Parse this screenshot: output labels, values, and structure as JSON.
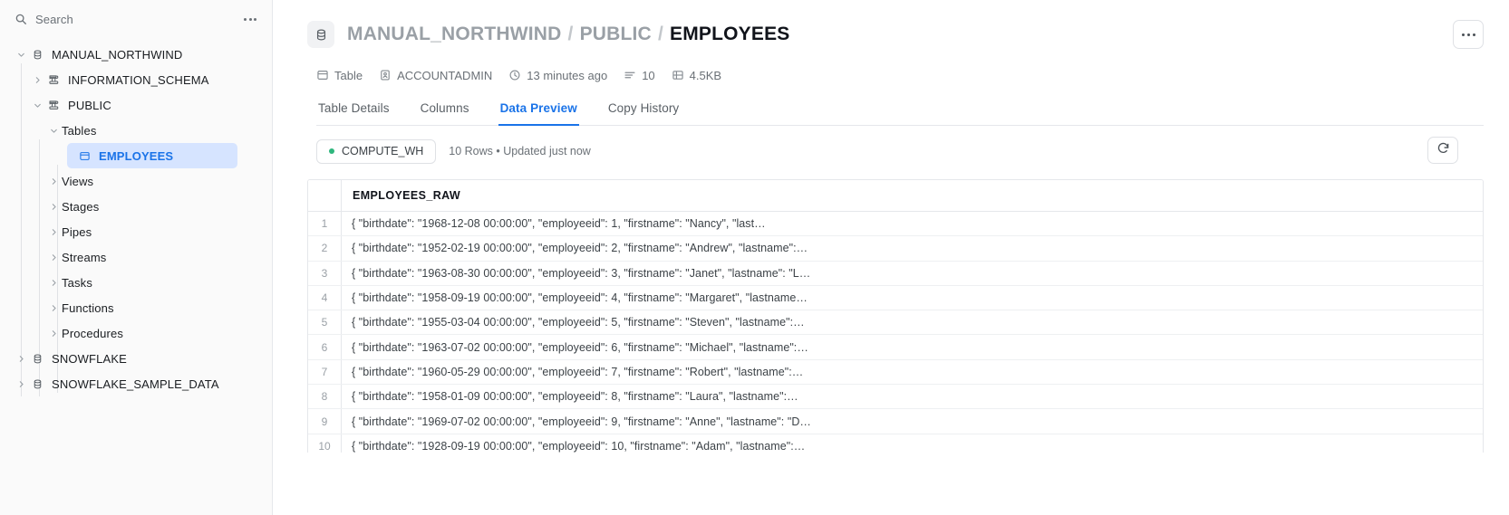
{
  "sidebar": {
    "search": {
      "placeholder": "Search",
      "icon": "search-icon"
    },
    "overflow_icon": "kebab-menu-icon",
    "tree": [
      {
        "label": "MANUAL_NORTHWIND",
        "level": 0,
        "icon": "database-icon",
        "expanded": true,
        "chevron": "chevron-down-icon"
      },
      {
        "label": "INFORMATION_SCHEMA",
        "level": 1,
        "icon": "schema-icon",
        "expanded": false,
        "chevron": "chevron-right-icon"
      },
      {
        "label": "PUBLIC",
        "level": 1,
        "icon": "schema-icon",
        "expanded": true,
        "chevron": "chevron-down-icon"
      },
      {
        "label": "Tables",
        "level": 2,
        "icon": "",
        "expanded": true,
        "chevron": "chevron-down-icon"
      },
      {
        "label": "EMPLOYEES",
        "level": 3,
        "icon": "table-icon",
        "expanded": false,
        "chevron": "",
        "selected": true
      },
      {
        "label": "Views",
        "level": 2,
        "icon": "",
        "expanded": false,
        "chevron": "chevron-right-icon"
      },
      {
        "label": "Stages",
        "level": 2,
        "icon": "",
        "expanded": false,
        "chevron": "chevron-right-icon"
      },
      {
        "label": "Pipes",
        "level": 2,
        "icon": "",
        "expanded": false,
        "chevron": "chevron-right-icon"
      },
      {
        "label": "Streams",
        "level": 2,
        "icon": "",
        "expanded": false,
        "chevron": "chevron-right-icon"
      },
      {
        "label": "Tasks",
        "level": 2,
        "icon": "",
        "expanded": false,
        "chevron": "chevron-right-icon"
      },
      {
        "label": "Functions",
        "level": 2,
        "icon": "",
        "expanded": false,
        "chevron": "chevron-right-icon"
      },
      {
        "label": "Procedures",
        "level": 2,
        "icon": "",
        "expanded": false,
        "chevron": "chevron-right-icon"
      },
      {
        "label": "SNOWFLAKE",
        "level": 0,
        "icon": "database-icon",
        "expanded": false,
        "chevron": "chevron-right-icon"
      },
      {
        "label": "SNOWFLAKE_SAMPLE_DATA",
        "level": 0,
        "icon": "database-icon",
        "expanded": false,
        "chevron": "chevron-right-icon"
      }
    ]
  },
  "header": {
    "badge_icon": "database-icon",
    "breadcrumb": {
      "database": "MANUAL_NORTHWIND",
      "schema": "PUBLIC",
      "object": "EMPLOYEES",
      "separator": "/"
    },
    "overflow_icon": "kebab-menu-icon"
  },
  "meta": [
    {
      "icon": "table-icon",
      "label": "Table"
    },
    {
      "icon": "user-badge-icon",
      "label": "ACCOUNTADMIN"
    },
    {
      "icon": "clock-icon",
      "label": "13 minutes ago"
    },
    {
      "icon": "rows-icon",
      "label": "10"
    },
    {
      "icon": "storage-icon",
      "label": "4.5KB"
    }
  ],
  "tabs": [
    {
      "label": "Table Details",
      "active": false
    },
    {
      "label": "Columns",
      "active": false
    },
    {
      "label": "Data Preview",
      "active": true
    },
    {
      "label": "Copy History",
      "active": false
    }
  ],
  "status": {
    "warehouse": "COMPUTE_WH",
    "warehouse_dot_color": "#2eb67d",
    "summary": "10 Rows • Updated just now",
    "refresh_icon": "refresh-icon"
  },
  "grid": {
    "column_header": "EMPLOYEES_RAW",
    "rows": [
      {
        "n": "1",
        "value": "{   \"birthdate\": \"1968-12-08 00:00:00\",   \"employeeid\": 1,   \"firstname\": \"Nancy\",   \"last…"
      },
      {
        "n": "2",
        "value": "{   \"birthdate\": \"1952-02-19 00:00:00\",   \"employeeid\": 2,   \"firstname\": \"Andrew\",   \"lastname\":…"
      },
      {
        "n": "3",
        "value": "{   \"birthdate\": \"1963-08-30 00:00:00\",   \"employeeid\": 3,   \"firstname\": \"Janet\",   \"lastname\": \"L…"
      },
      {
        "n": "4",
        "value": "{   \"birthdate\": \"1958-09-19 00:00:00\",   \"employeeid\": 4,   \"firstname\": \"Margaret\",   \"lastname…"
      },
      {
        "n": "5",
        "value": "{   \"birthdate\": \"1955-03-04 00:00:00\",   \"employeeid\": 5,   \"firstname\": \"Steven\",   \"lastname\":…"
      },
      {
        "n": "6",
        "value": "{   \"birthdate\": \"1963-07-02 00:00:00\",   \"employeeid\": 6,   \"firstname\": \"Michael\",   \"lastname\":…"
      },
      {
        "n": "7",
        "value": "{   \"birthdate\": \"1960-05-29 00:00:00\",   \"employeeid\": 7,   \"firstname\": \"Robert\",   \"lastname\":…"
      },
      {
        "n": "8",
        "value": "{   \"birthdate\": \"1958-01-09 00:00:00\",   \"employeeid\": 8,   \"firstname\": \"Laura\",   \"lastname\":…"
      },
      {
        "n": "9",
        "value": "{   \"birthdate\": \"1969-07-02 00:00:00\",   \"employeeid\": 9,   \"firstname\": \"Anne\",   \"lastname\": \"D…"
      },
      {
        "n": "10",
        "value": "{   \"birthdate\": \"1928-09-19 00:00:00\",   \"employeeid\": 10,   \"firstname\": \"Adam\",   \"lastname\":…"
      }
    ]
  }
}
